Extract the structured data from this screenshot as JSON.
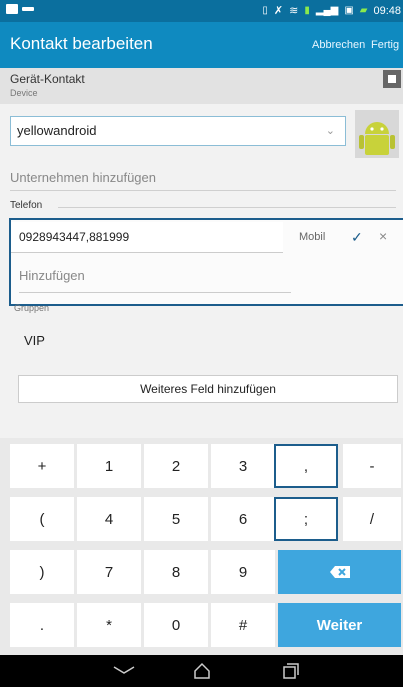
{
  "status_bar": {
    "time": "09:48"
  },
  "app_bar": {
    "title": "Kontakt bearbeiten",
    "cancel_label": "Abbrechen",
    "done_label": "Fertig"
  },
  "account": {
    "name": "Gerät-Kontakt",
    "sub": "Device"
  },
  "form": {
    "name_value": "yellowandroid",
    "company_placeholder": "Unternehmen hinzufügen",
    "phone_section_label": "Telefon",
    "phone_number": "0928943447,881999",
    "phone_type": "Mobil",
    "phone_add_placeholder": "Hinzufügen",
    "groups_label": "Gruppen",
    "group_value": "VIP",
    "add_field_label": "Weiteres Feld hinzufügen"
  },
  "keyboard": {
    "rows": [
      [
        "+",
        "1",
        "2",
        "3",
        ",",
        "-"
      ],
      [
        "(",
        "4",
        "5",
        "6",
        ";",
        "/"
      ],
      [
        ")",
        "7",
        "8",
        "9"
      ],
      [
        ".",
        "*",
        "0",
        "#"
      ]
    ],
    "next_label": "Weiter"
  }
}
